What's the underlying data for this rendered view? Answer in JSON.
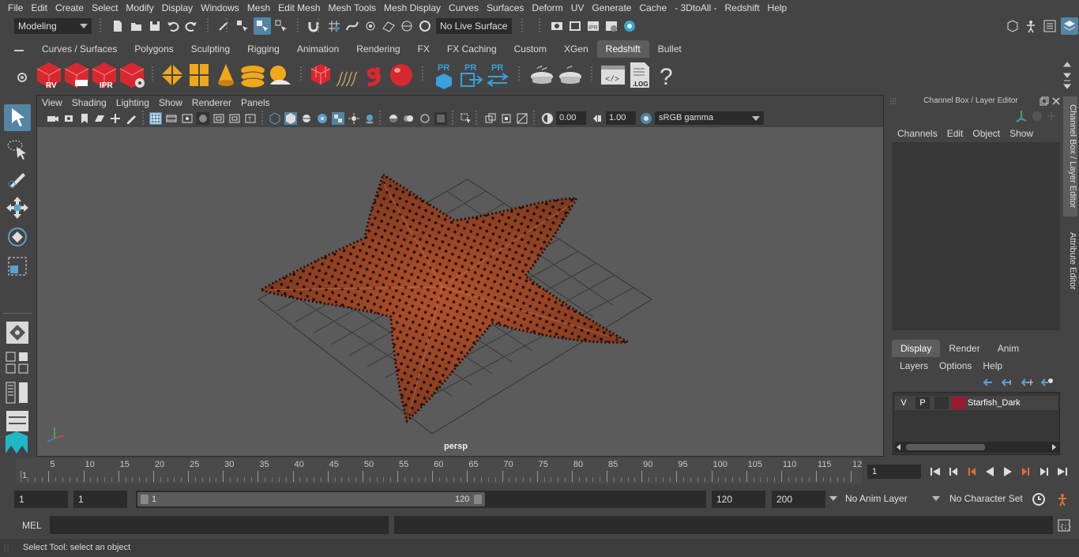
{
  "menubar": [
    "File",
    "Edit",
    "Create",
    "Select",
    "Modify",
    "Display",
    "Windows",
    "Mesh",
    "Edit Mesh",
    "Mesh Tools",
    "Mesh Display",
    "Curves",
    "Surfaces",
    "Deform",
    "UV",
    "Generate",
    "Cache",
    "- 3DtoAll -",
    "Redshift",
    "Help"
  ],
  "statusline": {
    "workspace": "Modeling",
    "live_surface": "No Live Surface"
  },
  "shelf": {
    "tabs": [
      "Curves / Surfaces",
      "Polygons",
      "Sculpting",
      "Rigging",
      "Animation",
      "Rendering",
      "FX",
      "FX Caching",
      "Custom",
      "XGen",
      "Redshift",
      "Bullet"
    ],
    "active_tab": "Redshift",
    "icon_labels": {
      "rv": "RV",
      "ipr": "IPR",
      "pr": "PR",
      "log": ".LOG",
      "help": "?"
    }
  },
  "viewport": {
    "menu": [
      "View",
      "Shading",
      "Lighting",
      "Show",
      "Renderer",
      "Panels"
    ],
    "exposure": "0.00",
    "gamma": "1.00",
    "color_space": "sRGB gamma",
    "camera": "persp"
  },
  "channelbox": {
    "title": "Channel Box / Layer Editor",
    "menu": [
      "Channels",
      "Edit",
      "Object",
      "Show"
    ],
    "layer_tabs": [
      "Display",
      "Render",
      "Anim"
    ],
    "active_layer_tab": "Display",
    "layer_menu": [
      "Layers",
      "Options",
      "Help"
    ],
    "layers": [
      {
        "v": "V",
        "p": "P",
        "name": "Starfish_Dark",
        "color": "#9a1a2e"
      }
    ]
  },
  "side_tabs": [
    "Channel Box / Layer Editor",
    "Attribute Editor"
  ],
  "timeslider": {
    "ticks": [
      "1",
      "5",
      "10",
      "15",
      "20",
      "25",
      "30",
      "35",
      "40",
      "45",
      "50",
      "55",
      "60",
      "65",
      "70",
      "75",
      "80",
      "85",
      "90",
      "95",
      "100",
      "105",
      "110",
      "115",
      "12"
    ],
    "current_frame": "1"
  },
  "rangeslider": {
    "start": "1",
    "playback_start": "1",
    "range_start_label": "1",
    "range_end_label": "120",
    "playback_end": "120",
    "end": "200",
    "anim_layer": "No Anim Layer",
    "character_set": "No Character Set"
  },
  "cmdline": {
    "label": "MEL"
  },
  "helpline": {
    "text": "Select Tool: select an object"
  },
  "colors": {
    "accent": "#5285a6",
    "starfish": "#b3512c",
    "starfish_dark": "#3a1a10"
  }
}
